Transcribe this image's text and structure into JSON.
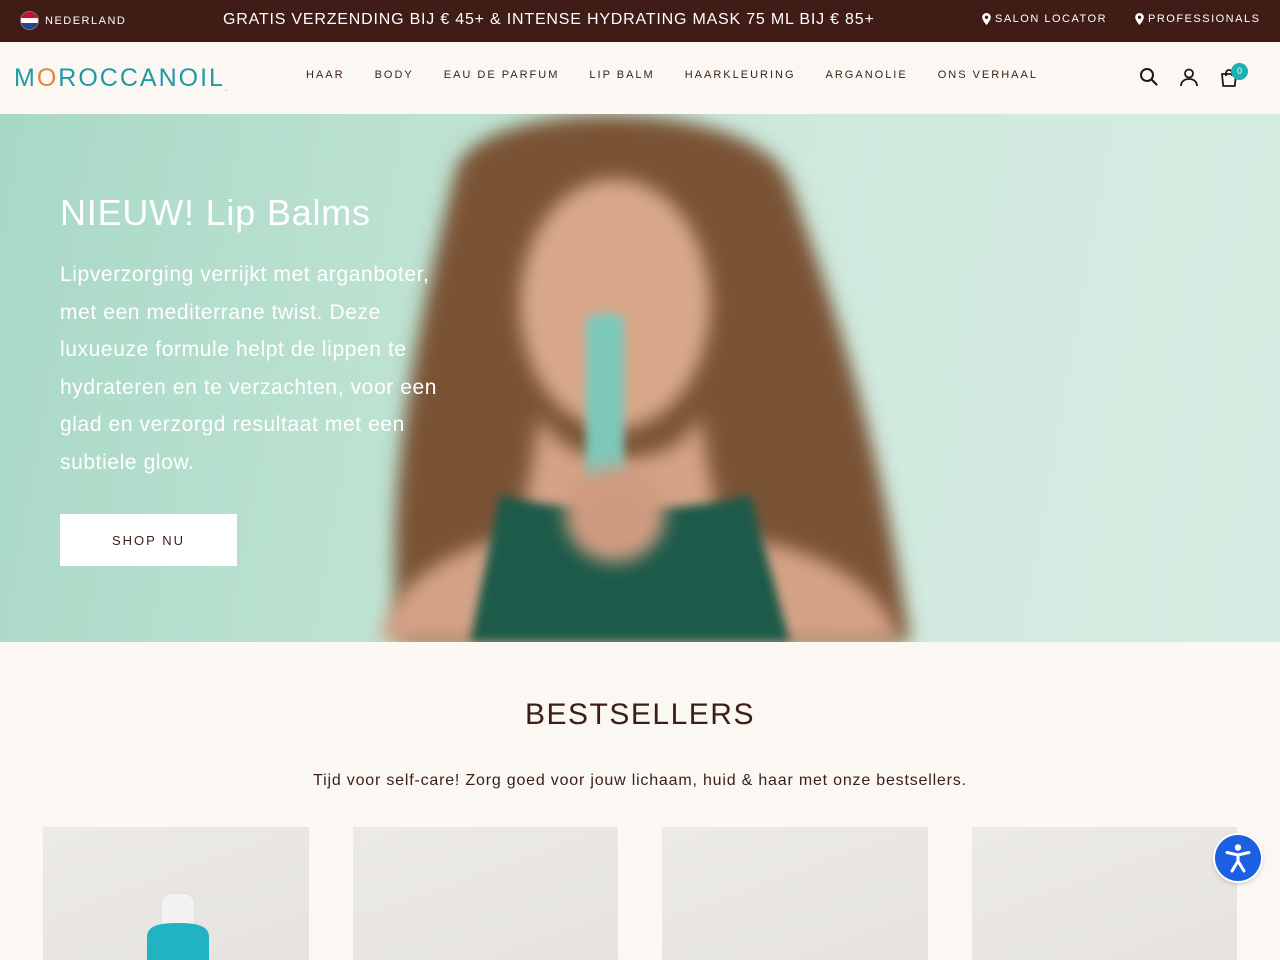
{
  "topbar": {
    "country": "NEDERLAND",
    "promo": "GRATIS VERZENDING BIJ € 45+ & INTENSE HYDRATING MASK 75 ML BIJ € 85+",
    "salon_locator": "SALON LOCATOR",
    "professionals": "PROFESSIONALS"
  },
  "header": {
    "logo": "MOROCCANOIL",
    "nav": [
      "HAAR",
      "BODY",
      "EAU DE PARFUM",
      "LIP BALM",
      "HAARKLEURING",
      "ARGANOLIE",
      "ONS VERHAAL"
    ],
    "cart_count": "0"
  },
  "hero": {
    "title": "NIEUW! Lip Balms",
    "text": "Lipverzorging verrijkt met arganboter, met een mediterrane twist. Deze luxueuze formule helpt de lippen te hydrateren en te verzachten, voor een glad en verzorgd resultaat met een subtiele glow.",
    "button": "SHOP NU"
  },
  "bestsellers": {
    "title": "BESTSELLERS",
    "subtitle": "Tijd voor self-care! Zorg goed voor jouw lichaam, huid & haar met onze bestsellers."
  },
  "colors": {
    "topbar_bg": "#3f1d16",
    "brand_teal": "#1f9aa5",
    "brand_orange": "#e2853b",
    "text_brown": "#3b1f17",
    "page_bg": "#fbf7f3",
    "cart_badge": "#1bb2b0",
    "a11y_blue": "#1c5fe0"
  },
  "icons": [
    "nl-flag-icon",
    "pin-icon",
    "search-icon",
    "account-icon",
    "cart-icon",
    "accessibility-icon"
  ]
}
